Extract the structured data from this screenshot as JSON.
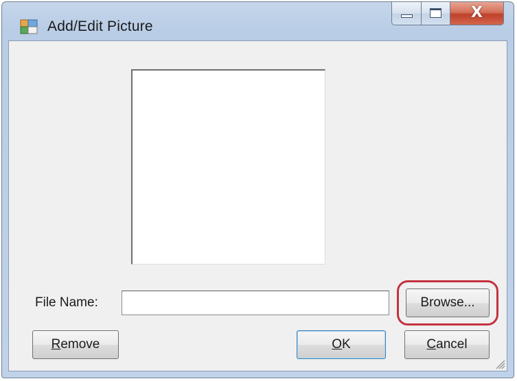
{
  "window": {
    "title": "Add/Edit Picture"
  },
  "caption_buttons": {
    "minimize_icon": "minimize-icon",
    "maximize_icon": "maximize-icon",
    "close_icon": "close-icon",
    "close_glyph": "X"
  },
  "form": {
    "file_name_label": "File Name:",
    "file_name_value": "",
    "file_name_placeholder": ""
  },
  "buttons": {
    "browse": "Browse...",
    "remove": "Remove",
    "ok": "OK",
    "cancel": "Cancel"
  },
  "colors": {
    "highlight": "#c4323f",
    "close_button": "#c0412a",
    "title_bar": "#b9cde6",
    "client_bg": "#f0f0f0"
  }
}
